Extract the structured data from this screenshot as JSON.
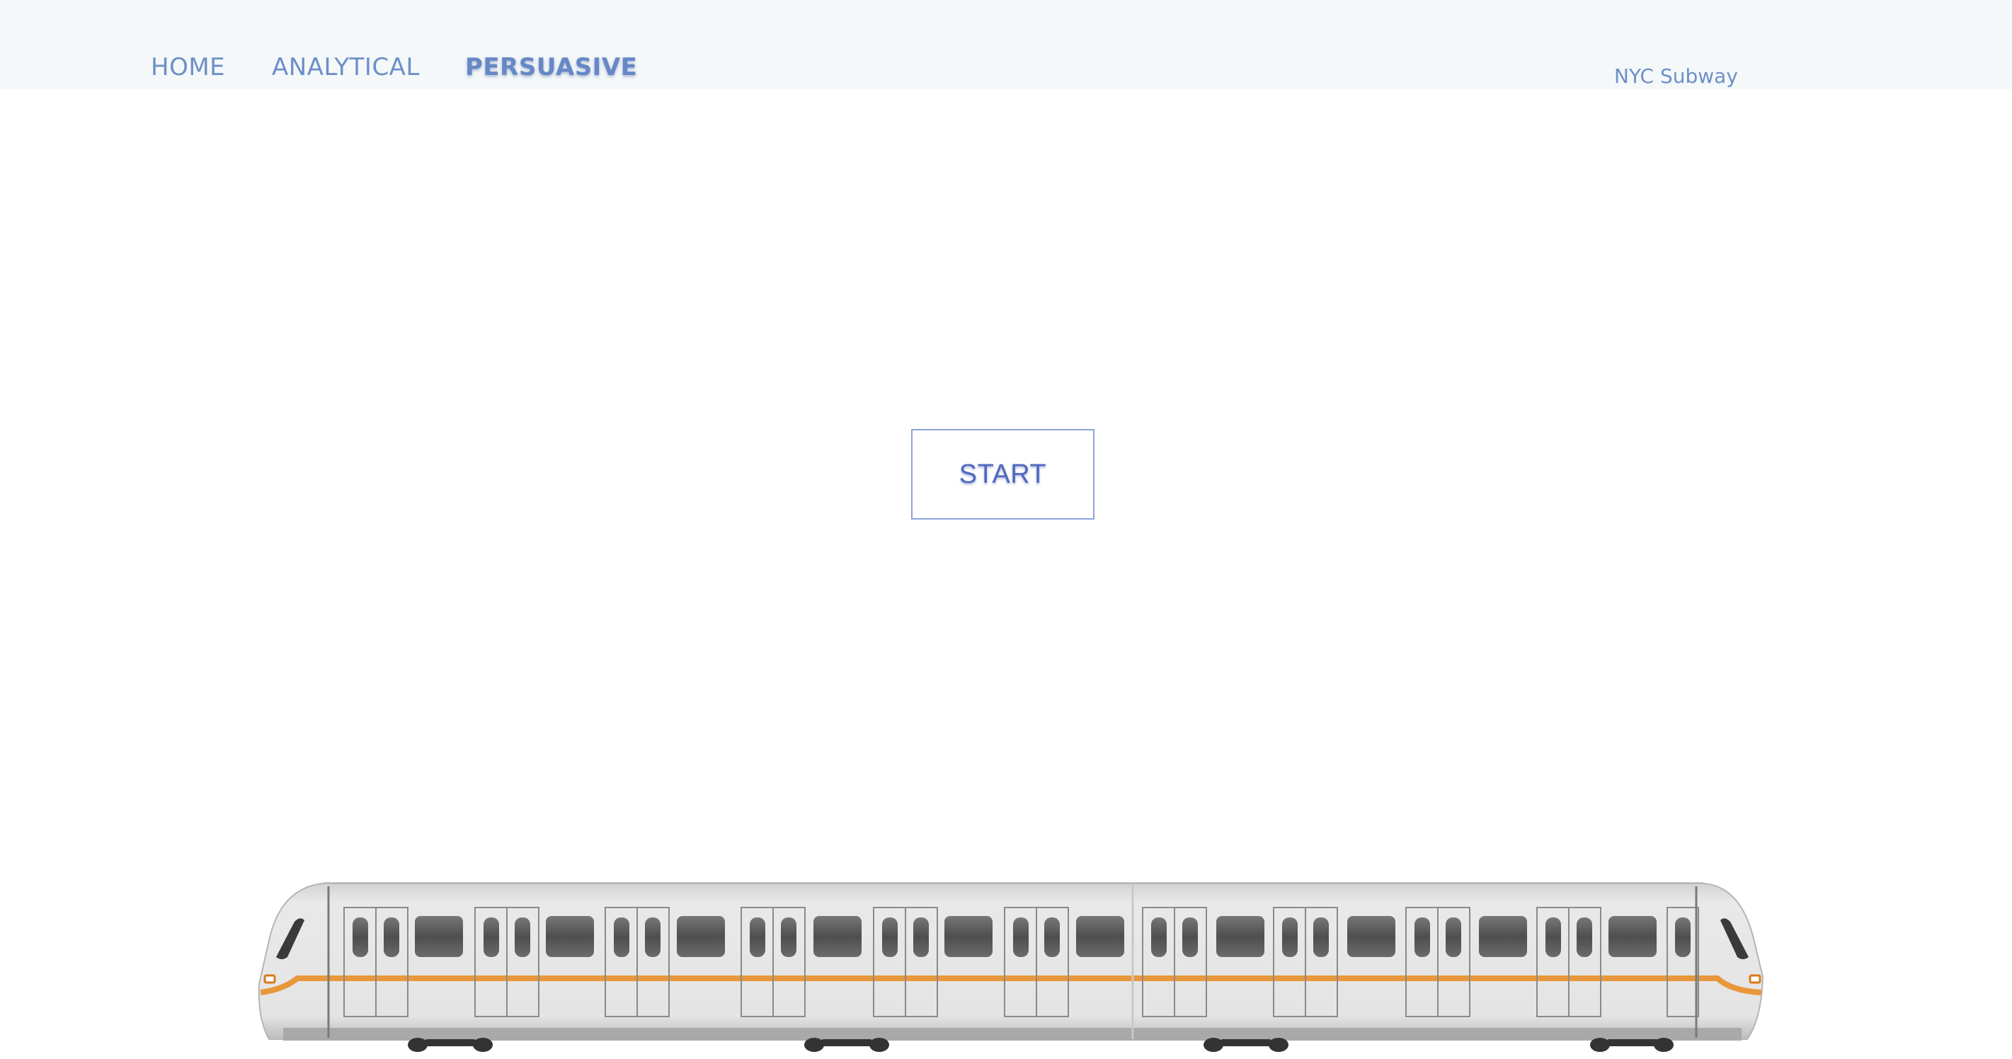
{
  "nav": {
    "items": [
      {
        "label": "HOME",
        "active": false
      },
      {
        "label": "ANALYTICAL",
        "active": false
      },
      {
        "label": "PERSUASIVE",
        "active": true
      }
    ]
  },
  "brand": {
    "label": "NYC Subway"
  },
  "main": {
    "start_label": "START"
  },
  "colors": {
    "topbar_bg": "#f4f8f9",
    "nav_text": "#6d8fc8",
    "button_border": "#8ea3d8",
    "button_text": "#4f68be",
    "train_stripe": "#e8973a",
    "train_body": "#e4e4e4",
    "train_window": "#5a5a5a"
  },
  "illustration": {
    "name": "subway-train"
  }
}
